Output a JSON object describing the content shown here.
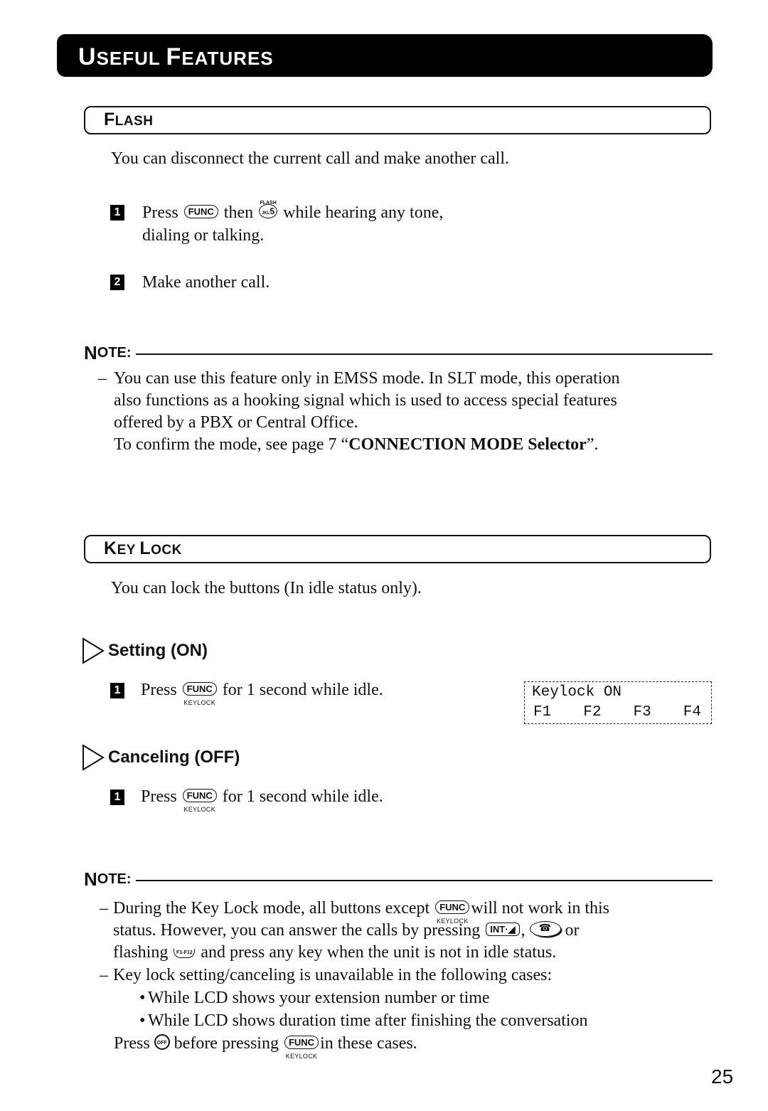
{
  "header": {
    "title_first": "U",
    "title_rest1": "SEFUL ",
    "title_second": "F",
    "title_rest2": "EATURES"
  },
  "flash": {
    "title_first": "F",
    "title_rest": "LASH",
    "intro": "You can disconnect the current call and make another call.",
    "steps": [
      {
        "num": "1",
        "pre": "Press",
        "key1": "FUNC",
        "mid": "then",
        "key2_sup": "FLASH",
        "key2_sub": "JKL",
        "key2": "5",
        "post": "while hearing any tone,",
        "line2": "dialing or talking."
      },
      {
        "num": "2",
        "text": "Make another call."
      }
    ],
    "note": {
      "label_first": "N",
      "label_rest": "OTE:",
      "dash": "–",
      "lines": [
        "You can use this feature only in EMSS mode. In SLT mode, this operation",
        "also functions as a hooking signal which is used to access special features",
        "offered by a PBX or Central Office."
      ],
      "confirm_pre": "To confirm the mode, see page 7 “",
      "confirm_link": "CONNECTION MODE Selector",
      "confirm_post": "”."
    }
  },
  "keylock": {
    "title_first": "K",
    "title_rest1": "EY ",
    "title_second": "L",
    "title_rest2": "OCK",
    "intro": "You can lock the buttons (In idle status only).",
    "setting": {
      "heading": "Setting (ON)",
      "step": {
        "num": "1",
        "pre": "Press",
        "key": "FUNC",
        "key_sub": "KEYLOCK",
        "post": "for 1 second while idle."
      }
    },
    "lcd": {
      "line1": "Keylock ON",
      "softkeys": [
        "F1",
        "F2",
        "F3",
        "F4"
      ]
    },
    "canceling": {
      "heading": "Canceling (OFF)",
      "step": {
        "num": "1",
        "pre": "Press",
        "key": "FUNC",
        "key_sub": "KEYLOCK",
        "post": "for 1 second while idle."
      }
    },
    "note": {
      "label_first": "N",
      "label_rest": "OTE:",
      "item1_pre": "During the Key Lock mode, all buttons except",
      "item1_key": "FUNC",
      "item1_key_sub": "KEYLOCK",
      "item1_post": "will not work in this",
      "item1_line2_pre": "status. However, you can answer the calls by pressing",
      "int_key": "INT",
      "int_sep": ",",
      "item1_line2_post": "or",
      "item1_line3_pre": "flashing",
      "flash_sup": "F1-F12",
      "item1_line3_post": "and press any key when the unit is not in idle status.",
      "item2": "Key lock setting/canceling is unavailable in the following cases:",
      "bullets": [
        "While LCD shows your extension number or time",
        "While LCD shows duration time after finishing the conversation"
      ],
      "final_pre": "Press",
      "off_key": "OFF",
      "final_mid": "before pressing",
      "final_key": "FUNC",
      "final_key_sub": "KEYLOCK",
      "final_post": "in these cases.",
      "dash": "–",
      "bullet": "•"
    }
  },
  "page_number": "25"
}
